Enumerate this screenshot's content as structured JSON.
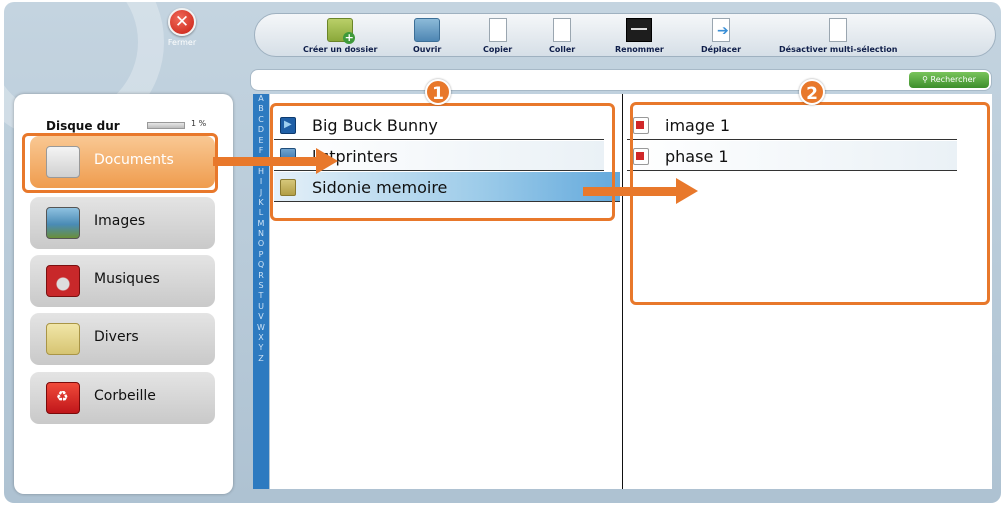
{
  "close": {
    "label": "Fermer"
  },
  "toolbar": [
    {
      "name": "create-folder-button",
      "icon": "new-folder-icon",
      "label": "Créer un dossier"
    },
    {
      "name": "open-button",
      "icon": "open-icon",
      "label": "Ouvrir"
    },
    {
      "name": "copy-button",
      "icon": "copy-icon",
      "label": "Copier"
    },
    {
      "name": "paste-button",
      "icon": "paste-icon",
      "label": "Coller"
    },
    {
      "name": "rename-button",
      "icon": "rename-icon",
      "label": "Renommer"
    },
    {
      "name": "move-button",
      "icon": "move-icon",
      "label": "Déplacer"
    },
    {
      "name": "multi-select-button",
      "icon": "multi-select-icon",
      "label": "Désactiver multi-sélection"
    }
  ],
  "disk": {
    "label": "Disque dur",
    "percent": "1 %"
  },
  "categories": [
    {
      "label": "Documents",
      "icon": "documents-icon",
      "active": true
    },
    {
      "label": "Images",
      "icon": "images-icon"
    },
    {
      "label": "Musiques",
      "icon": "music-icon"
    },
    {
      "label": "Divers",
      "icon": "folder-icon"
    },
    {
      "label": "Corbeille",
      "icon": "trash-icon"
    }
  ],
  "search": {
    "value": "",
    "button": "Rechercher"
  },
  "alphabet": [
    "A",
    "B",
    "C",
    "D",
    "E",
    "F",
    "G",
    "H",
    "I",
    "J",
    "K",
    "L",
    "M",
    "N",
    "O",
    "P",
    "Q",
    "R",
    "S",
    "T",
    "U",
    "V",
    "W",
    "X",
    "Y",
    "Z"
  ],
  "folders": [
    {
      "label": "Big Buck Bunny",
      "icon": "movie-icon"
    },
    {
      "label": "listprinters",
      "icon": "printer-icon"
    },
    {
      "label": "Sidonie memoire",
      "icon": "folder-icon",
      "selected": true
    }
  ],
  "files": [
    {
      "label": "image 1",
      "icon": "file-icon"
    },
    {
      "label": "phase 1",
      "icon": "file-icon"
    }
  ],
  "callouts": {
    "one": "1",
    "two": "2"
  },
  "colors": {
    "accent": "#e8782b",
    "alphabet_bar": "#2d7ac0",
    "search_button": "#4fa33a"
  }
}
